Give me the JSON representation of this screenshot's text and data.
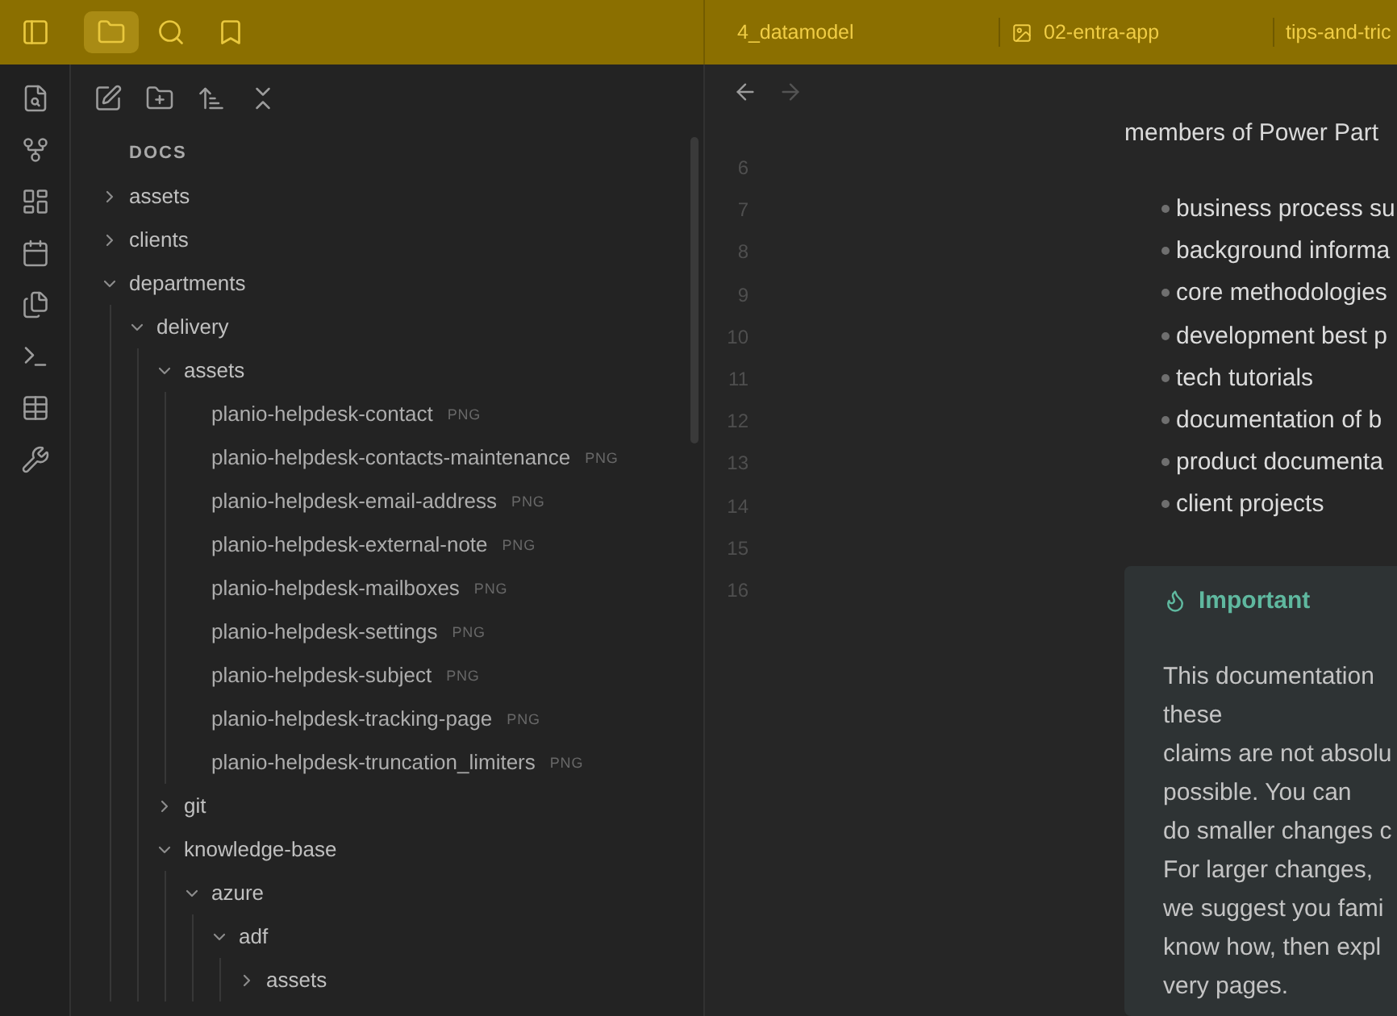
{
  "title_bar": {
    "actions": [
      {
        "kind": "sidebar",
        "selected": false
      },
      {
        "kind": "files",
        "selected": true
      },
      {
        "kind": "search",
        "selected": false
      },
      {
        "kind": "bookmarks",
        "selected": false
      }
    ],
    "tabs": [
      {
        "label": "4_datamodel",
        "kind": "note"
      },
      {
        "label": "02-entra-app",
        "kind": "image"
      },
      {
        "label": "tips-and-tric",
        "kind": "note"
      }
    ]
  },
  "file_explorer": {
    "root": "DOCS",
    "tree": [
      {
        "name": "assets",
        "kind": "folder",
        "expanded": false
      },
      {
        "name": "clients",
        "kind": "folder",
        "expanded": false
      },
      {
        "name": "departments",
        "kind": "folder",
        "expanded": true,
        "children": [
          {
            "name": "delivery",
            "kind": "folder",
            "expanded": true,
            "children": [
              {
                "name": "assets",
                "kind": "folder",
                "expanded": true,
                "children": [
                  {
                    "name": "planio-helpdesk-contact",
                    "kind": "file",
                    "extension": "PNG"
                  },
                  {
                    "name": "planio-helpdesk-contacts-maintenance",
                    "kind": "file",
                    "extension": "PNG"
                  },
                  {
                    "name": "planio-helpdesk-email-address",
                    "kind": "file",
                    "extension": "PNG"
                  },
                  {
                    "name": "planio-helpdesk-external-note",
                    "kind": "file",
                    "extension": "PNG"
                  },
                  {
                    "name": "planio-helpdesk-mailboxes",
                    "kind": "file",
                    "extension": "PNG"
                  },
                  {
                    "name": "planio-helpdesk-settings",
                    "kind": "file",
                    "extension": "PNG"
                  },
                  {
                    "name": "planio-helpdesk-subject",
                    "kind": "file",
                    "extension": "PNG"
                  },
                  {
                    "name": "planio-helpdesk-tracking-page",
                    "kind": "file",
                    "extension": "PNG"
                  },
                  {
                    "name": "planio-helpdesk-truncation_limiters",
                    "kind": "file",
                    "extension": "PNG"
                  }
                ]
              },
              {
                "name": "git",
                "kind": "folder",
                "expanded": false
              },
              {
                "name": "knowledge-base",
                "kind": "folder",
                "expanded": true,
                "children": [
                  {
                    "name": "azure",
                    "kind": "folder",
                    "expanded": true,
                    "children": [
                      {
                        "name": "adf",
                        "kind": "folder",
                        "expanded": true,
                        "children": [
                          {
                            "name": "assets",
                            "kind": "folder",
                            "expanded": false
                          }
                        ]
                      }
                    ]
                  }
                ]
              }
            ]
          }
        ]
      }
    ]
  },
  "editor": {
    "navigation": [
      {
        "kind": "back",
        "disabled": false
      },
      {
        "kind": "forward",
        "disabled": true
      }
    ],
    "line_numbers": [
      "6",
      "7",
      "8",
      "9",
      "10",
      "11",
      "12",
      "13",
      "14",
      "15",
      "16"
    ],
    "paragraph": "members of Power Part",
    "bullets": [
      "business process su",
      "background informa",
      "core methodologies",
      "development best p",
      "tech tutorials",
      "documentation of b",
      "product documenta",
      "client projects"
    ],
    "callout": {
      "kind": "important",
      "title": "Important",
      "lines": [
        "This documentation",
        "these",
        "claims are not absolu",
        "possible. You can",
        "do smaller changes c",
        "For larger changes,",
        "we suggest you fami",
        "know how, then expl",
        "very pages."
      ]
    }
  }
}
